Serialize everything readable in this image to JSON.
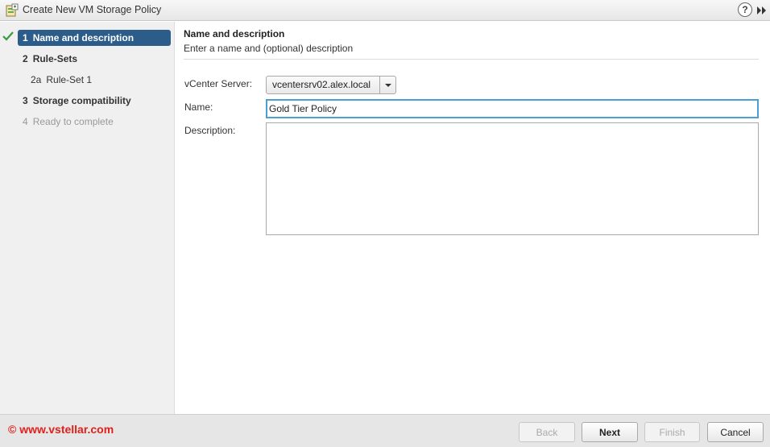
{
  "window": {
    "title": "Create New VM Storage Policy",
    "help_label": "?"
  },
  "sidebar": {
    "steps": [
      {
        "num": "1",
        "label": "Name and description",
        "state": "active",
        "completed": true
      },
      {
        "num": "2",
        "label": "Rule-Sets",
        "state": "normal"
      },
      {
        "num": "2a",
        "label": "Rule-Set 1",
        "state": "sub"
      },
      {
        "num": "3",
        "label": "Storage compatibility",
        "state": "normal"
      },
      {
        "num": "4",
        "label": "Ready to complete",
        "state": "disabled"
      }
    ]
  },
  "main": {
    "header_title": "Name and description",
    "header_subtitle": "Enter a name and (optional) description",
    "fields": {
      "vcenter_label": "vCenter Server:",
      "vcenter_value": "vcentersrv02.alex.local",
      "name_label": "Name:",
      "name_value": "Gold Tier Policy",
      "description_label": "Description:",
      "description_value": ""
    }
  },
  "footer": {
    "watermark": "© www.vstellar.com",
    "buttons": {
      "back": "Back",
      "next": "Next",
      "finish": "Finish",
      "cancel": "Cancel"
    }
  },
  "colors": {
    "active_step_bg": "#2c5c8a",
    "check_green": "#3c9a3c",
    "input_focus_border": "#4a9fd6",
    "watermark_red": "#e0201b"
  }
}
